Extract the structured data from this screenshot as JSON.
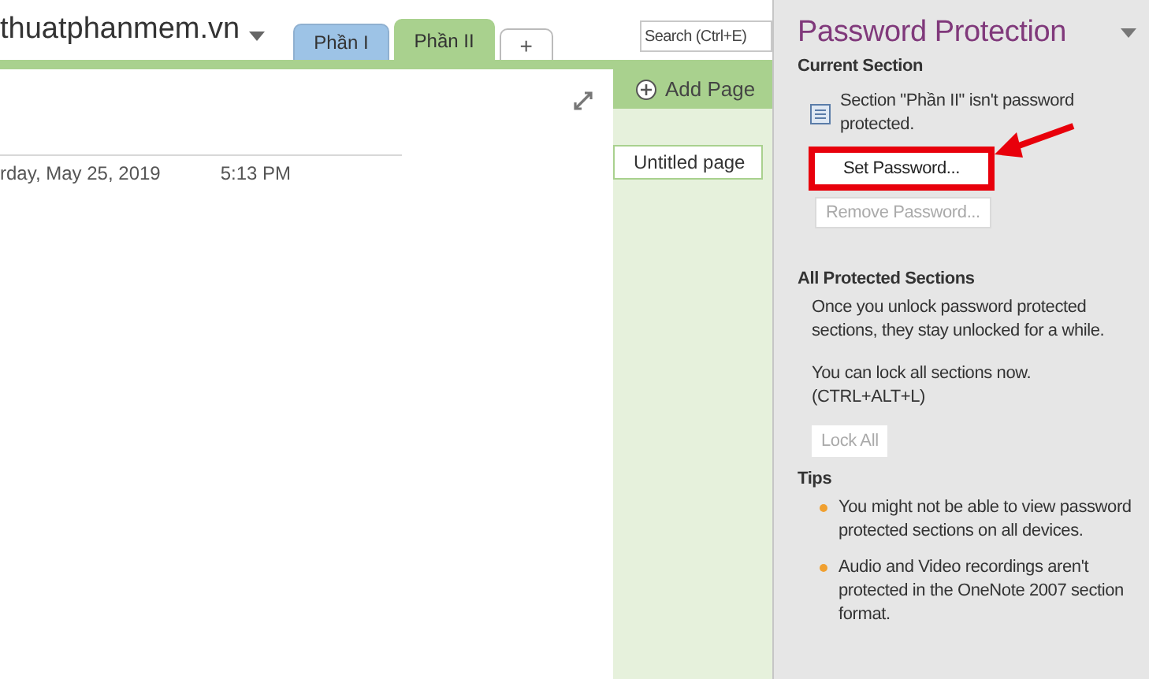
{
  "notebook": {
    "name": "thuatphanmem.vn"
  },
  "section_tabs": [
    {
      "label": "Phần I",
      "selected": false,
      "color": "#9dc3e6"
    },
    {
      "label": "Phần II",
      "selected": true,
      "color": "#a9d18e"
    }
  ],
  "add_section": {
    "label": "+"
  },
  "search": {
    "placeholder": "Search (Ctrl+E)"
  },
  "page": {
    "date": "rday, May 25, 2019",
    "time": "5:13 PM"
  },
  "page_list": {
    "add_page": "Add Page",
    "pages": [
      {
        "title": "Untitled page",
        "selected": true
      }
    ]
  },
  "pane": {
    "title": "Password Protection",
    "current_section": {
      "heading": "Current Section",
      "status": "Section \"Phần II\" isn't password protected.",
      "buttons": [
        {
          "label": "Set Password...",
          "disabled": false,
          "highlighted": true
        },
        {
          "label": "Remove Password...",
          "disabled": true,
          "highlighted": false
        }
      ]
    },
    "all_protected": {
      "heading": "All Protected Sections",
      "paragraphs": [
        "Once you unlock password protected sections, they stay unlocked for a while.",
        "You can lock all sections now.\n(CTRL+ALT+L)"
      ],
      "lock_all": {
        "label": "Lock All",
        "disabled": true
      }
    },
    "tips": {
      "heading": "Tips",
      "items": [
        "You might not be able to view password protected sections on all devices.",
        "Audio and Video recordings aren't protected in the OneNote 2007 section format."
      ]
    }
  }
}
